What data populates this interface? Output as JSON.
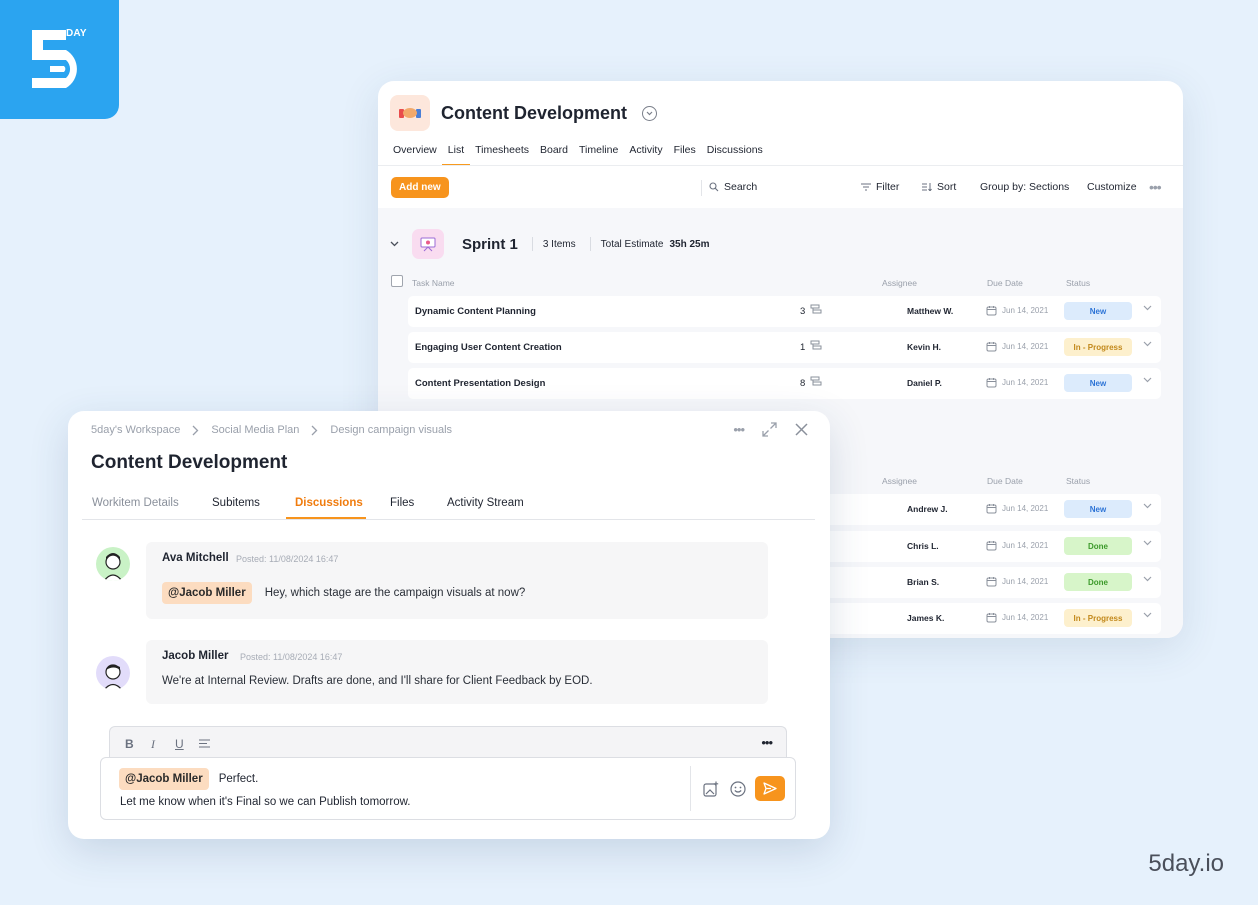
{
  "brand": {
    "logo_text": "DAY",
    "url": "5day.io"
  },
  "project": {
    "title": "Content Development",
    "tabs": [
      "Overview",
      "List",
      "Timesheets",
      "Board",
      "Timeline",
      "Activity",
      "Files",
      "Discussions"
    ],
    "active_tab": "List",
    "toolbar": {
      "add_new": "Add new",
      "search": "Search",
      "filter": "Filter",
      "sort": "Sort",
      "group_by": "Group by: Sections",
      "customize": "Customize"
    },
    "sprint": {
      "name": "Sprint 1",
      "items": "3 Items",
      "estimate_label": "Total Estimate",
      "estimate_value": "35h 25m"
    },
    "columns": {
      "task": "Task Name",
      "assignee": "Assignee",
      "due": "Due Date",
      "status": "Status"
    },
    "tasks": [
      {
        "name": "Dynamic Content Planning",
        "count": "3",
        "assignee": "Matthew W.",
        "due": "Jun 14, 2021",
        "status": "New"
      },
      {
        "name": "Engaging User Content Creation",
        "count": "1",
        "assignee": "Kevin H.",
        "due": "Jun 14, 2021",
        "status": "In - Progress"
      },
      {
        "name": "Content Presentation Design",
        "count": "8",
        "assignee": "Daniel P.",
        "due": "Jun 14, 2021",
        "status": "New"
      }
    ],
    "tasks2": [
      {
        "assignee": "Andrew J.",
        "due": "Jun 14, 2021",
        "status": "New"
      },
      {
        "assignee": "Chris L.",
        "due": "Jun 14, 2021",
        "status": "Done"
      },
      {
        "assignee": "Brian S.",
        "due": "Jun 14, 2021",
        "status": "Done"
      },
      {
        "assignee": "James K.",
        "due": "Jun 14, 2021",
        "status": "In - Progress"
      }
    ]
  },
  "workitem": {
    "breadcrumb": [
      "5day's Workspace",
      "Social Media Plan",
      "Design campaign visuals"
    ],
    "title": "Content Development",
    "tabs": [
      "Workitem Details",
      "Subitems",
      "Discussions",
      "Files",
      "Activity Stream"
    ],
    "active_tab": "Discussions",
    "messages": [
      {
        "author": "Ava Mitchell",
        "posted": "Posted: 11/08/2024 16:47",
        "mention": "@Jacob Miller",
        "text": "Hey, which stage are the campaign visuals at now?"
      },
      {
        "author": "Jacob Miller",
        "posted": "Posted: 11/08/2024 16:47",
        "text": "We're at Internal Review. Drafts are done, and I'll share for Client Feedback by EOD."
      }
    ],
    "composer": {
      "mention": "@Jacob Miller",
      "line1": "Perfect.",
      "line2": "Let me know when it's Final so we can Publish tomorrow.",
      "format_buttons": [
        "B",
        "I",
        "U"
      ]
    }
  },
  "colors": {
    "accent": "#f7941d",
    "logo_bg": "#2ba4f0",
    "background": "#e6f1fc"
  }
}
